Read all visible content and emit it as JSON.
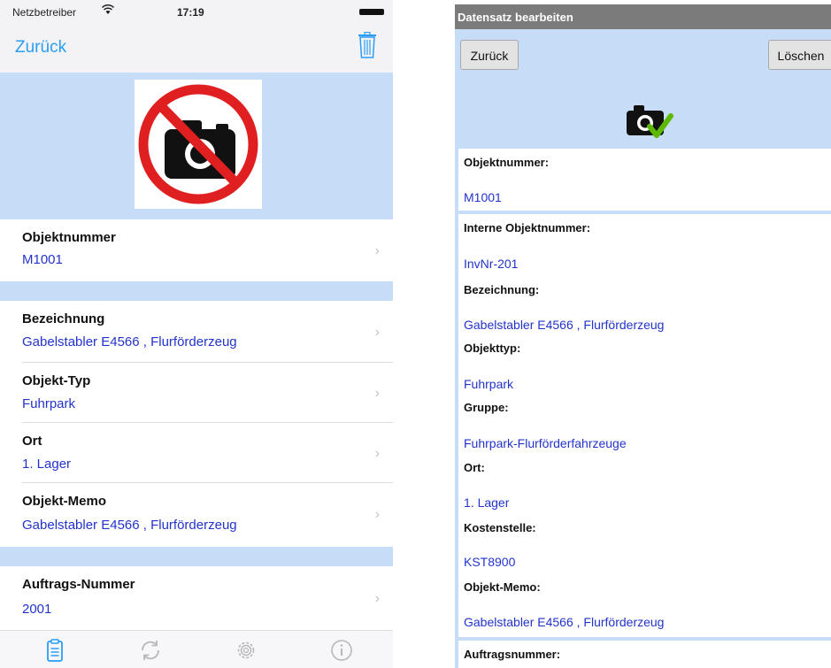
{
  "ios": {
    "status": {
      "carrier": "Netzbetreiber",
      "time": "17:19"
    },
    "nav": {
      "back_label": "Zurück",
      "trash_icon": "trash-icon"
    },
    "hero": {
      "photo_icon": "no-camera-icon"
    },
    "rows": [
      {
        "label": "Objektnummer",
        "value": "M1001"
      },
      {
        "label": "Bezeichnung",
        "value": "Gabelstabler E4566 , Flurförderzeug"
      },
      {
        "label": "Objekt-Typ",
        "value": "Fuhrpark"
      },
      {
        "label": "Ort",
        "value": "1. Lager"
      },
      {
        "label": "Objekt-Memo",
        "value": "Gabelstabler E4566 , Flurförderzeug"
      },
      {
        "label": "Auftrags-Nummer",
        "value": "2001"
      }
    ],
    "tabbar": [
      "clipboard-icon",
      "sync-icon",
      "settings-icon",
      "info-icon"
    ]
  },
  "android": {
    "title": "Datensatz bearbeiten",
    "back_label": "Zurück",
    "delete_label": "Löschen",
    "camera_icon": "camera-check-icon",
    "fields": [
      {
        "label": "Objektnummer:",
        "value": "M1001"
      },
      {
        "label": "Interne Objektnummer:",
        "value": "InvNr-201"
      },
      {
        "label": "Bezeichnung:",
        "value": "Gabelstabler E4566 , Flurförderzeug"
      },
      {
        "label": "Objekttyp:",
        "value": "Fuhrpark"
      },
      {
        "label": "Gruppe:",
        "value": "Fuhrpark-Flurförderfahrzeuge"
      },
      {
        "label": "Ort:",
        "value": "1. Lager"
      },
      {
        "label": "Kostenstelle:",
        "value": "KST8900"
      },
      {
        "label": "Objekt-Memo:",
        "value": "Gabelstabler E4566 , Flurförderzeug"
      },
      {
        "label": "Auftragsnummer:",
        "value": ""
      }
    ]
  },
  "colors": {
    "ios_accent": "#2a9df4",
    "value_text": "#2233cc",
    "hero_bg": "#c7dcf7",
    "android_title_bg": "#7b7b7b"
  }
}
